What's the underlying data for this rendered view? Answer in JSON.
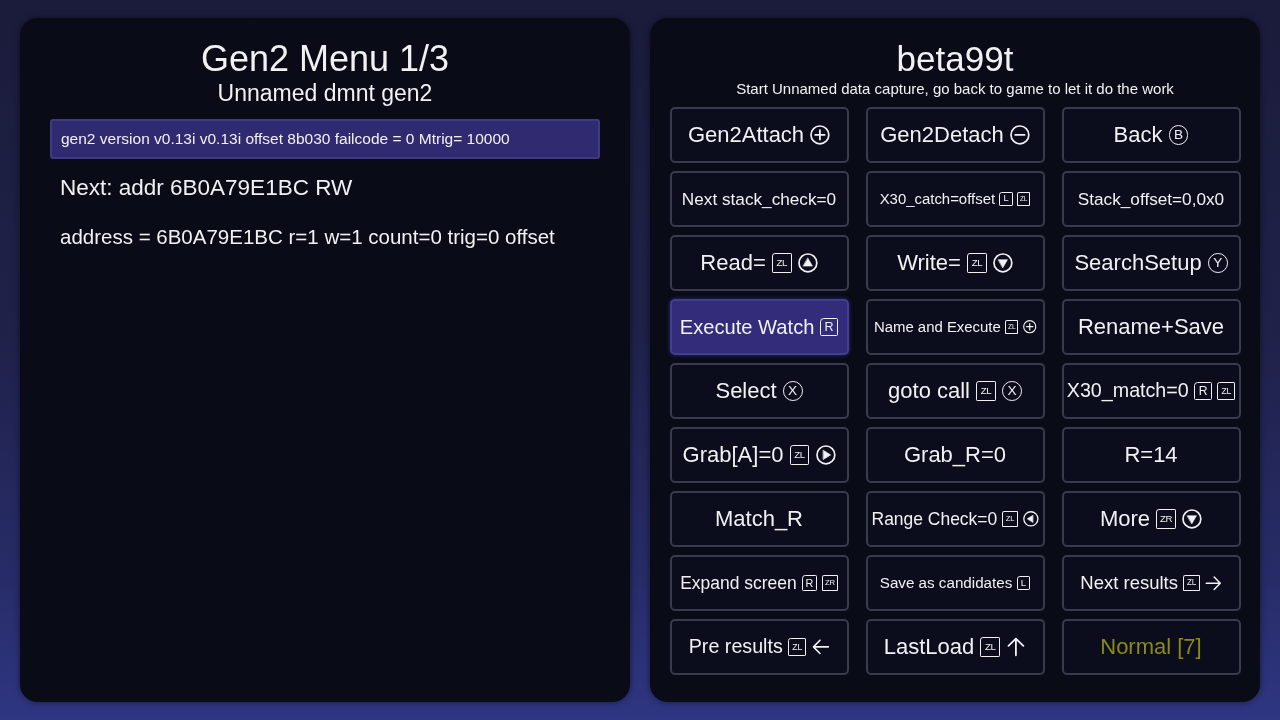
{
  "left_panel": {
    "title": "Gen2 Menu 1/3",
    "subtitle": "Unnamed dmnt gen2",
    "status_bar": "gen2 version v0.13i v0.13i offset 8b030 failcode = 0 Mtrig= 10000",
    "lines": [
      "Next: addr 6B0A79E1BC RW",
      "address = 6B0A79E1BC r=1 w=1 count=0 trig=0 offset"
    ]
  },
  "right_panel": {
    "title": "beta99t",
    "subtitle": "Start Unnamed data capture, go back to game to let it do the work",
    "buttons": [
      {
        "label": "Gen2Attach",
        "selected": false,
        "icons": [
          {
            "kind": "plus-circle"
          }
        ]
      },
      {
        "label": "Gen2Detach",
        "selected": false,
        "icons": [
          {
            "kind": "minus-circle"
          }
        ]
      },
      {
        "label": "Back",
        "selected": false,
        "icons": [
          {
            "kind": "letter-circle",
            "text": "B"
          }
        ]
      },
      {
        "label": "Next stack_check=0",
        "selected": false
      },
      {
        "label": "X30_catch=offset",
        "selected": false,
        "icons": [
          {
            "kind": "letter-square",
            "text": "L"
          },
          {
            "kind": "letter-square",
            "text": "ZL"
          }
        ]
      },
      {
        "label": "Stack_offset=0,0x0",
        "selected": false
      },
      {
        "label": "Read=",
        "selected": false,
        "icons": [
          {
            "kind": "letter-square",
            "text": "ZL"
          },
          {
            "kind": "up-circle"
          }
        ]
      },
      {
        "label": "Write=",
        "selected": false,
        "icons": [
          {
            "kind": "letter-square",
            "text": "ZL"
          },
          {
            "kind": "down-circle"
          }
        ]
      },
      {
        "label": "SearchSetup",
        "selected": false,
        "icons": [
          {
            "kind": "letter-circle",
            "text": "Y"
          }
        ]
      },
      {
        "label": "Execute Watch",
        "selected": true,
        "icons": [
          {
            "kind": "letter-square",
            "text": "R"
          }
        ]
      },
      {
        "label": "Name and Execute",
        "selected": false,
        "icons": [
          {
            "kind": "letter-square",
            "text": "ZL"
          },
          {
            "kind": "plus-circle"
          }
        ]
      },
      {
        "label": "Rename+Save",
        "selected": false
      },
      {
        "label": "Select",
        "selected": false,
        "icons": [
          {
            "kind": "letter-circle",
            "text": "X"
          }
        ]
      },
      {
        "label": "goto call",
        "selected": false,
        "icons": [
          {
            "kind": "letter-square",
            "text": "ZL"
          },
          {
            "kind": "letter-circle",
            "text": "X"
          }
        ]
      },
      {
        "label": "X30_match=0",
        "selected": false,
        "icons": [
          {
            "kind": "letter-square",
            "text": "R"
          },
          {
            "kind": "letter-square",
            "text": "ZL"
          }
        ]
      },
      {
        "label": "Grab[A]=0",
        "selected": false,
        "icons": [
          {
            "kind": "letter-square",
            "text": "ZL"
          },
          {
            "kind": "right-circle"
          }
        ]
      },
      {
        "label": "Grab_R=0",
        "selected": false
      },
      {
        "label": "R=14",
        "selected": false
      },
      {
        "label": "Match_R",
        "selected": false
      },
      {
        "label": "Range Check=0",
        "selected": false,
        "icons": [
          {
            "kind": "letter-square",
            "text": "ZL"
          },
          {
            "kind": "left-circle"
          }
        ]
      },
      {
        "label": "More",
        "selected": false,
        "icons": [
          {
            "kind": "letter-square",
            "text": "ZR"
          },
          {
            "kind": "down-circle"
          }
        ]
      },
      {
        "label": "Expand screen",
        "selected": false,
        "icons": [
          {
            "kind": "letter-square",
            "text": "R"
          },
          {
            "kind": "letter-square",
            "text": "ZR"
          }
        ]
      },
      {
        "label": "Save as candidates",
        "selected": false,
        "icons": [
          {
            "kind": "letter-square",
            "text": "L"
          }
        ]
      },
      {
        "label": "Next results",
        "selected": false,
        "icons": [
          {
            "kind": "letter-square",
            "text": "ZL"
          },
          {
            "kind": "arrow-right"
          }
        ]
      },
      {
        "label": "Pre results",
        "selected": false,
        "icons": [
          {
            "kind": "letter-square",
            "text": "ZL"
          },
          {
            "kind": "arrow-left"
          }
        ]
      },
      {
        "label": "LastLoad",
        "selected": false,
        "icons": [
          {
            "kind": "letter-square",
            "text": "ZL"
          },
          {
            "kind": "arrow-up"
          }
        ]
      },
      {
        "label": "Normal [7]",
        "selected": false,
        "color": "#8a8a16"
      }
    ]
  }
}
